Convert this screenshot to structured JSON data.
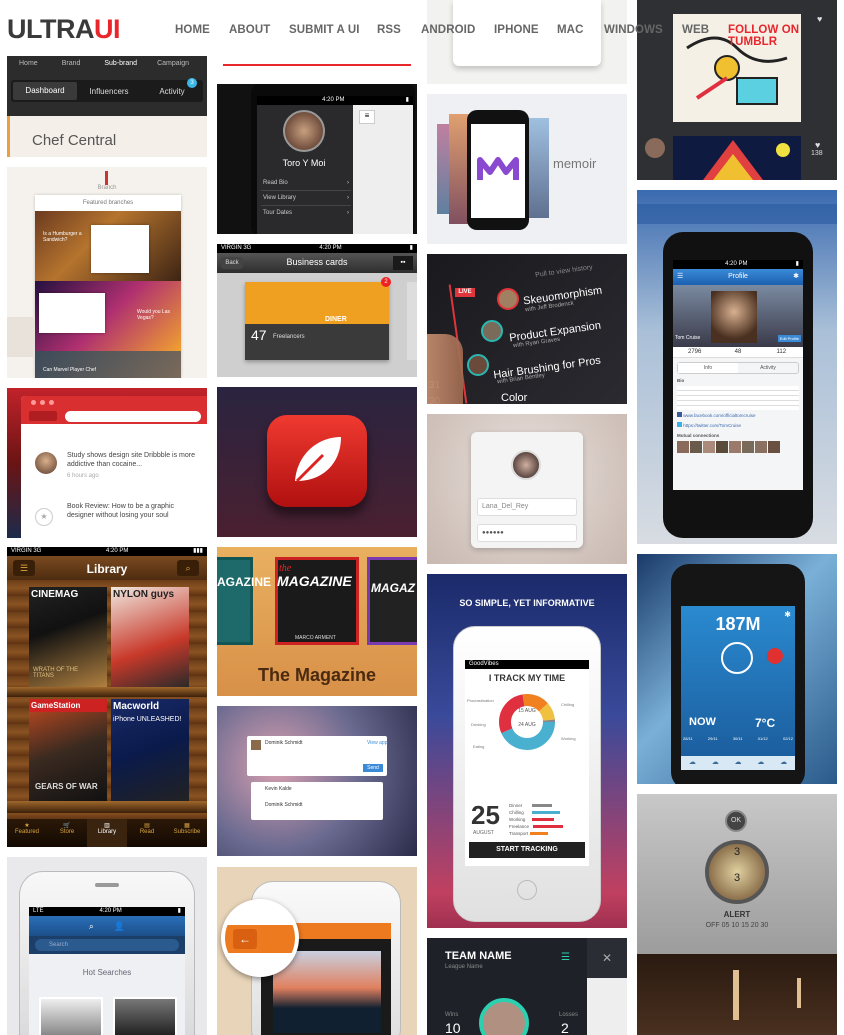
{
  "site": {
    "logo_main": "ULTRA",
    "logo_accent": "UI"
  },
  "nav": [
    "HOME",
    "ABOUT",
    "SUBMIT A UI",
    "RSS",
    "ANDROID",
    "IPHONE",
    "MAC",
    "WINDOWS",
    "WEB"
  ],
  "follow": "FOLLOW ON TUMBLR",
  "tiles": {
    "brand_nav": {
      "crumbs": [
        "Home",
        "Brand",
        "Sub-brand",
        "Campaign"
      ],
      "tabs": [
        "Dashboard",
        "Influencers",
        "Activity"
      ],
      "badge": "3",
      "title": "Chef Central"
    },
    "branch": {
      "label": "Branch",
      "heading": "Featured branches",
      "caption1": "Is a Humburger a Sandwich?",
      "caption2": "Would you Las Vegas?",
      "caption3": "Can Marvel Player Chef"
    },
    "study": {
      "item1": "Study shows design site Dribbble is more addictive than cocaine...",
      "time1": "6 hours ago",
      "item2": "Book Review: How to be a graphic designer without losing your soul",
      "time2": "8 hours ago"
    },
    "library": {
      "carrier": "VIRGIN 3G",
      "time": "4:20 PM",
      "title": "Library",
      "mags": [
        "CINEMAG",
        "NYLON guys",
        "WRATH OF THE TITANS",
        "GameStation",
        "Macworld",
        "GEARS OF WAR",
        "iPhone UNLEASHED!"
      ],
      "tabs": [
        "Featured",
        "Store",
        "Library",
        "Read",
        "Subscribe"
      ]
    },
    "hot": {
      "carrier": "LTE",
      "time": "4:20 PM",
      "search_ph": "Search",
      "heading": "Hot Searches"
    },
    "toro": {
      "time": "4:20 PM",
      "name": "Toro Y Moi",
      "menu": [
        "Read Bio",
        "View Library",
        "Tour Dates"
      ]
    },
    "cards": {
      "carrier": "VIRGIN 3G",
      "time": "4:20 PM",
      "back": "Back",
      "title": "Business cards",
      "count": "47",
      "label": "Freelancers",
      "brand": "DINER",
      "badge": "2"
    },
    "magazine": {
      "t1": "MAGAZINE",
      "t2": "MAGAZINE",
      "t3": "MAGAZ",
      "the": "the",
      "author": "MARCO ARMENT",
      "title": "The Magazine"
    },
    "social": {
      "n1": "Dominik Schmidt",
      "n2": "Kevin Kalde",
      "n3": "Dominik Schmidt",
      "send": "Send",
      "link": "View app"
    },
    "memoir": {
      "name": "memoir"
    },
    "skeu": {
      "pull": "Pull to view history",
      "live": "LIVE",
      "t1": "Skeuomorphism",
      "s1": "with Jeff Brodenck",
      "t2": "Product Expansion",
      "s2": "with Ryan Graves",
      "t3": "Hair Brushing for Pros",
      "s3": "with Brian Bentley",
      "t4": "Color",
      "n1": "31",
      "n2": "30"
    },
    "login": {
      "user": "Lana_Del_Rey",
      "pw": "●●●●●●"
    },
    "track": {
      "top": "SO SIMPLE, YET INFORMATIVE",
      "carrier": "GoodVibes",
      "title": "I TRACK MY TIME",
      "date1": "15 AUG",
      "date2": "24 AUG",
      "big": "25",
      "month": "AUGUST",
      "btn": "START TRACKING",
      "rows": [
        "Dinner",
        "Chilling",
        "Working",
        "Freelance",
        "Transport"
      ],
      "pie_labels": [
        "Procrastination",
        "Chilling",
        "Working",
        "Drinking",
        "Eating"
      ]
    },
    "team": {
      "name": "TEAM NAME",
      "sub": "League Name",
      "wins_l": "Wins",
      "wins": "10",
      "loss_l": "Losses",
      "loss": "2"
    },
    "profile": {
      "time": "4:20 PM",
      "title": "Profile",
      "name": "Tom Cruise",
      "edit": "Edit Profile",
      "stats": [
        "2796",
        "48",
        "112"
      ],
      "tabs": [
        "Info",
        "Activity"
      ],
      "bio": "Bio",
      "fb": "www.facebook.com/officialtomcruise",
      "tw": "https://twitter.com/TomCruise",
      "mutual": "Mutual connections",
      "likes": "138"
    },
    "weather": {
      "alt": "187M",
      "now": "NOW",
      "temp": "7°C",
      "d1": "28/11",
      "d2": "29/11",
      "d3": "30/11",
      "d4": "01/12",
      "d5": "02/12"
    },
    "alert": {
      "ok": "OK",
      "n1": "3",
      "n2": "3",
      "label": "ALERT",
      "scale": "OFF  05  10  15  20  30"
    }
  }
}
